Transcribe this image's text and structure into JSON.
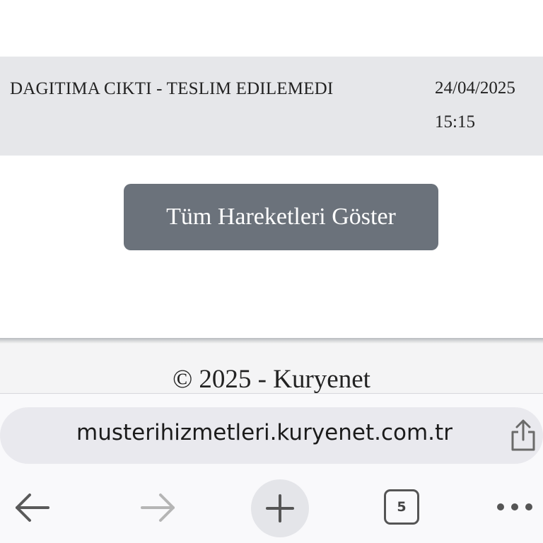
{
  "status": {
    "text": "DAGITIMA CIKTI - TESLIM EDILEMEDI",
    "date": "24/04/2025",
    "time": "15:15"
  },
  "actions": {
    "show_all_label": "Tüm Hareketleri Göster"
  },
  "footer": {
    "copyright": "© 2025 - Kuryenet"
  },
  "browser": {
    "url": "musterihizmetleri.kuryenet.com.tr",
    "tab_count": "5",
    "icons": {
      "share": "share-icon",
      "back": "arrow-left-icon",
      "forward": "arrow-right-icon",
      "new_tab": "plus-icon",
      "tabs": "tabs-icon",
      "more": "ellipsis-icon"
    }
  }
}
